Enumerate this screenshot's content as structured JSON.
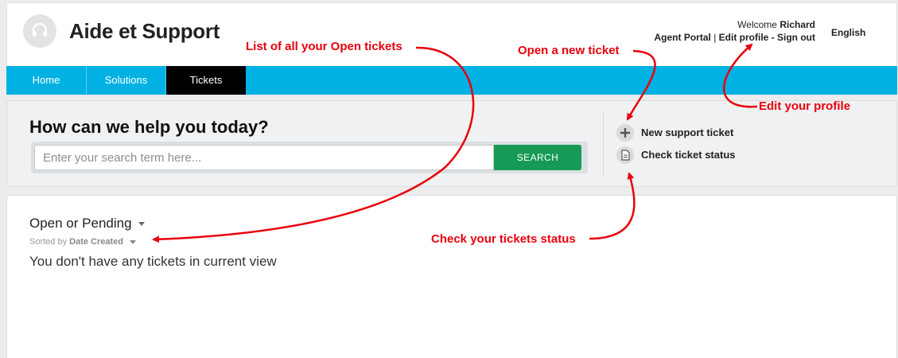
{
  "header": {
    "site_title": "Aide et Support",
    "welcome_prefix": "Welcome ",
    "user_name": "Richard",
    "agent_portal": "Agent Portal",
    "separator": " | ",
    "edit_profile": "Edit profile",
    "dash": " - ",
    "sign_out": "Sign out",
    "language": "English"
  },
  "nav": {
    "tabs": [
      {
        "label": "Home"
      },
      {
        "label": "Solutions"
      },
      {
        "label": "Tickets",
        "active": true
      }
    ]
  },
  "search": {
    "heading": "How can we help you today?",
    "placeholder": "Enter your search term here...",
    "button_label": "SEARCH"
  },
  "actions": {
    "new_ticket": "New support ticket",
    "check_status": "Check ticket status"
  },
  "tickets": {
    "filter": "Open or Pending",
    "sorted_prefix": "Sorted by ",
    "sorted_field": "Date Created",
    "empty_message": "You don't have any tickets in current view"
  },
  "annotations": {
    "open_tickets": "List of all your Open tickets",
    "new_ticket": "Open a new ticket",
    "edit_profile": "Edit your profile",
    "check_status": "Check your tickets status"
  },
  "colors": {
    "nav_bar": "#00b2e3",
    "active_tab": "#000000",
    "search_button": "#169a55",
    "annotation": "#e8000d"
  },
  "icons": {
    "logo": "headset-icon",
    "new_ticket": "plus-icon",
    "check_status": "document-icon",
    "dropdown": "caret-down-icon"
  }
}
